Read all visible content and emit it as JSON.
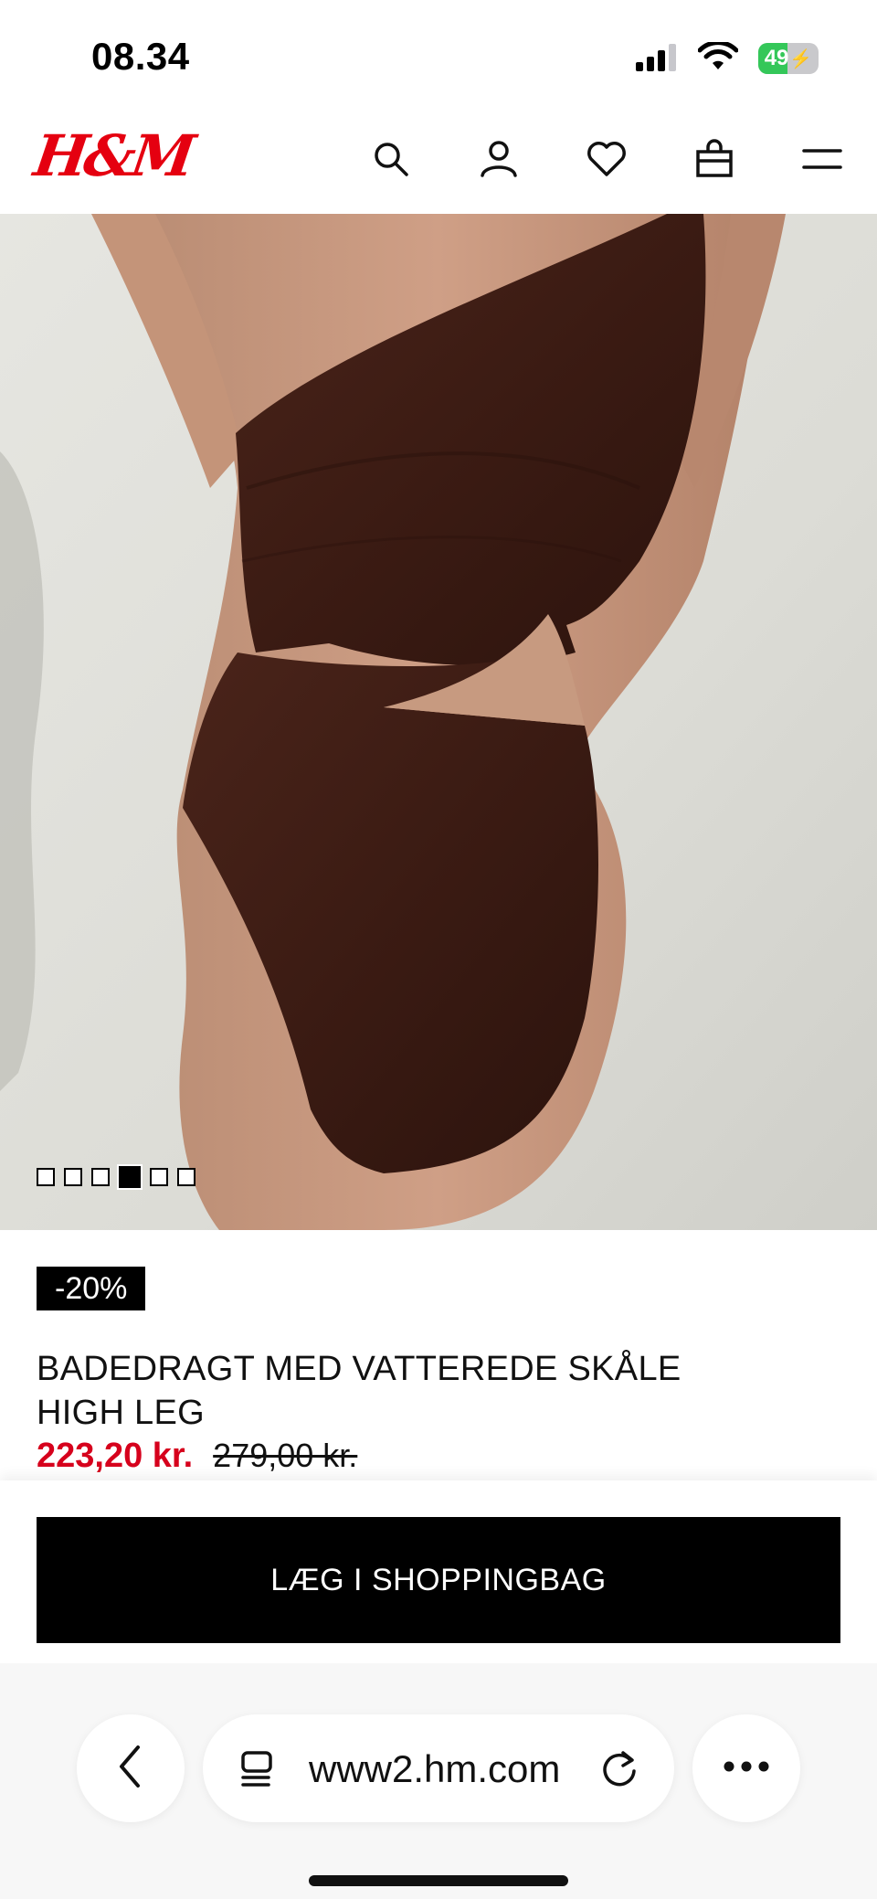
{
  "status_bar": {
    "time": "08.34",
    "battery_percent": 49,
    "battery_label": "49",
    "battery_charging": true,
    "battery_color": "#34c759",
    "icons": [
      "cellular-signal-icon",
      "wifi-icon",
      "battery-icon"
    ]
  },
  "header": {
    "logo": "H&M",
    "brand_color": "#e50010",
    "icons": [
      "search-icon",
      "account-icon",
      "favorites-heart-icon",
      "shopping-bag-icon",
      "menu-icon"
    ]
  },
  "gallery": {
    "image_count": 6,
    "active_index": 3
  },
  "product": {
    "discount_badge": "-20%",
    "title_line1": "BADEDRAGT MED VATTEREDE SKÅLE",
    "title_line2": "HIGH LEG",
    "sale_price": "223,20 kr.",
    "original_price": "279,00 kr.",
    "sale_price_color": "#d6001c"
  },
  "actions": {
    "add_to_bag_label": "LÆG I SHOPPINGBAG"
  },
  "browser": {
    "url": "www2.hm.com",
    "icons": [
      "back-chevron-icon",
      "tab-list-icon",
      "reload-icon",
      "more-dots-icon"
    ]
  }
}
